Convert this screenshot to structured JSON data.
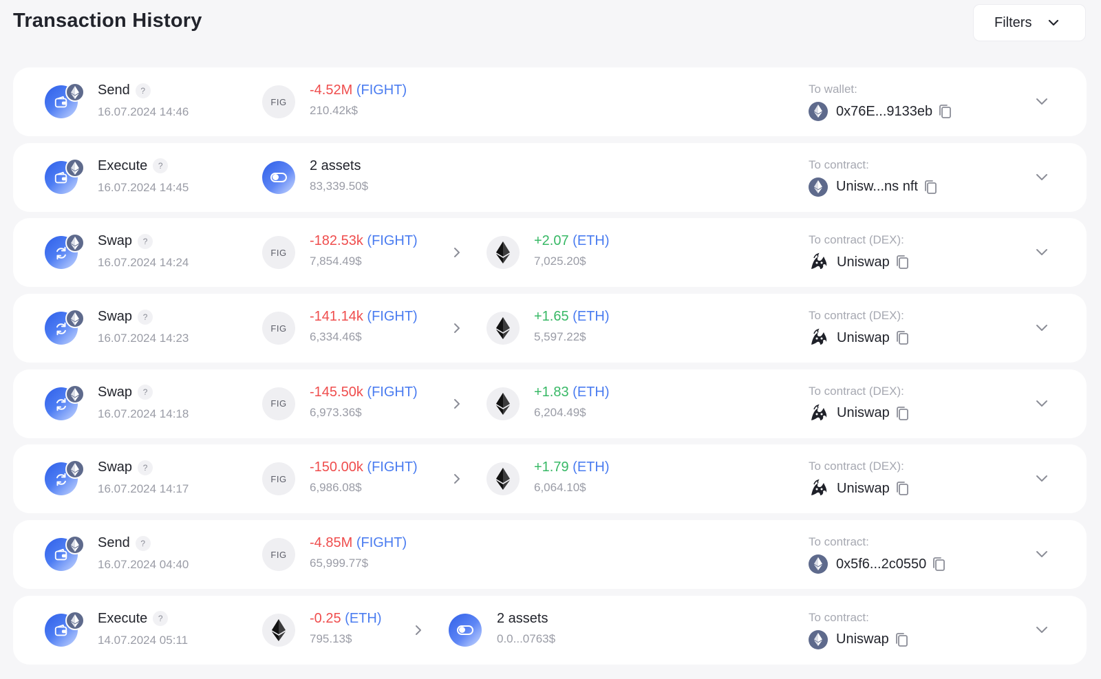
{
  "header": {
    "title": "Transaction History",
    "filters_label": "Filters"
  },
  "help_glyph": "?",
  "transactions": [
    {
      "type": "Send",
      "type_icon": "wallet-icon",
      "date": "16.07.2024 14:46",
      "from": {
        "icon": "FIG",
        "amount": "-4.52M",
        "symbol": "(FIGHT)",
        "usd": "210.42k$",
        "tone": "neg"
      },
      "to": null,
      "dest_label": "To wallet:",
      "dest_icon": "ethereum-icon",
      "dest_value": "0x76E...9133eb"
    },
    {
      "type": "Execute",
      "type_icon": "wallet-icon",
      "date": "16.07.2024 14:45",
      "from": {
        "icon": "multi",
        "amount": "2 assets",
        "symbol": "",
        "usd": "83,339.50$",
        "tone": "plain"
      },
      "to": null,
      "dest_label": "To contract:",
      "dest_icon": "ethereum-icon",
      "dest_value": "Unisw...ns nft"
    },
    {
      "type": "Swap",
      "type_icon": "swap-icon",
      "date": "16.07.2024 14:24",
      "from": {
        "icon": "FIG",
        "amount": "-182.53k",
        "symbol": "(FIGHT)",
        "usd": "7,854.49$",
        "tone": "neg"
      },
      "to": {
        "icon": "ETH",
        "amount": "+2.07",
        "symbol": "(ETH)",
        "usd": "7,025.20$",
        "tone": "pos"
      },
      "dest_label": "To contract (DEX):",
      "dest_icon": "uniswap-icon",
      "dest_value": "Uniswap"
    },
    {
      "type": "Swap",
      "type_icon": "swap-icon",
      "date": "16.07.2024 14:23",
      "from": {
        "icon": "FIG",
        "amount": "-141.14k",
        "symbol": "(FIGHT)",
        "usd": "6,334.46$",
        "tone": "neg"
      },
      "to": {
        "icon": "ETH",
        "amount": "+1.65",
        "symbol": "(ETH)",
        "usd": "5,597.22$",
        "tone": "pos"
      },
      "dest_label": "To contract (DEX):",
      "dest_icon": "uniswap-icon",
      "dest_value": "Uniswap"
    },
    {
      "type": "Swap",
      "type_icon": "swap-icon",
      "date": "16.07.2024 14:18",
      "from": {
        "icon": "FIG",
        "amount": "-145.50k",
        "symbol": "(FIGHT)",
        "usd": "6,973.36$",
        "tone": "neg"
      },
      "to": {
        "icon": "ETH",
        "amount": "+1.83",
        "symbol": "(ETH)",
        "usd": "6,204.49$",
        "tone": "pos"
      },
      "dest_label": "To contract (DEX):",
      "dest_icon": "uniswap-icon",
      "dest_value": "Uniswap"
    },
    {
      "type": "Swap",
      "type_icon": "swap-icon",
      "date": "16.07.2024 14:17",
      "from": {
        "icon": "FIG",
        "amount": "-150.00k",
        "symbol": "(FIGHT)",
        "usd": "6,986.08$",
        "tone": "neg"
      },
      "to": {
        "icon": "ETH",
        "amount": "+1.79",
        "symbol": "(ETH)",
        "usd": "6,064.10$",
        "tone": "pos"
      },
      "dest_label": "To contract (DEX):",
      "dest_icon": "uniswap-icon",
      "dest_value": "Uniswap"
    },
    {
      "type": "Send",
      "type_icon": "wallet-icon",
      "date": "16.07.2024 04:40",
      "from": {
        "icon": "FIG",
        "amount": "-4.85M",
        "symbol": "(FIGHT)",
        "usd": "65,999.77$",
        "tone": "neg"
      },
      "to": null,
      "dest_label": "To contract:",
      "dest_icon": "ethereum-icon",
      "dest_value": "0x5f6...2c0550"
    },
    {
      "type": "Execute",
      "type_icon": "wallet-icon",
      "date": "14.07.2024 05:11",
      "from": {
        "icon": "ETH",
        "amount": "-0.25",
        "symbol": "(ETH)",
        "usd": "795.13$",
        "tone": "neg"
      },
      "to": {
        "icon": "multi",
        "amount": "2 assets",
        "symbol": "",
        "usd": "0.0...0763$",
        "tone": "plain"
      },
      "dest_label": "To contract:",
      "dest_icon": "ethereum-icon",
      "dest_value": "Uniswap"
    }
  ],
  "colors": {
    "negative": "#ef4d4d",
    "positive": "#37b865",
    "symbol": "#4a7cf0",
    "muted": "#9a9ca6",
    "background": "#f6f6f8"
  }
}
